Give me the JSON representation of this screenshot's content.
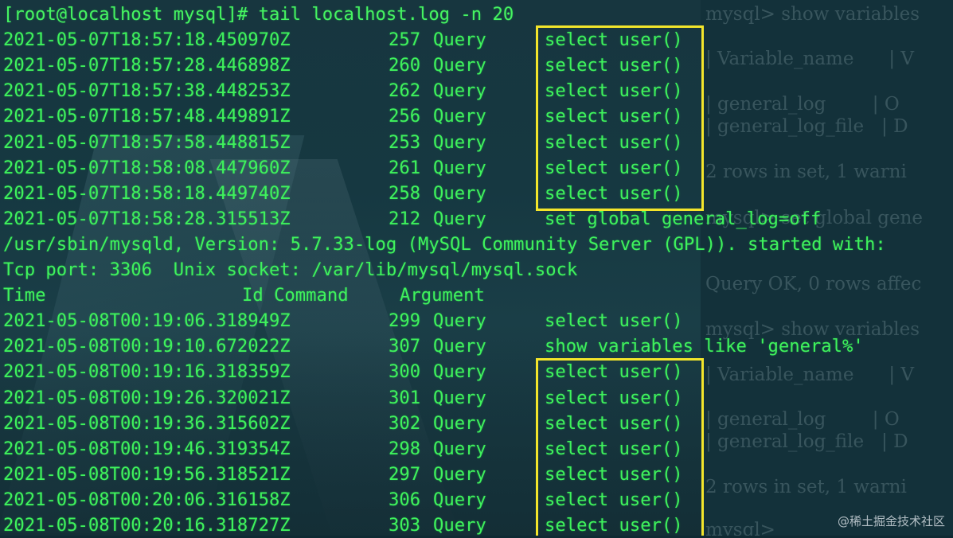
{
  "terminal": {
    "command_line": "[root@localhost mysql]# tail localhost.log -n 20",
    "log_lines_1": [
      {
        "time": "2021-05-07T18:57:18.450970Z",
        "id": "257",
        "command": "Query",
        "argument": "select user()"
      },
      {
        "time": "2021-05-07T18:57:28.446898Z",
        "id": "260",
        "command": "Query",
        "argument": "select user()"
      },
      {
        "time": "2021-05-07T18:57:38.448253Z",
        "id": "262",
        "command": "Query",
        "argument": "select user()"
      },
      {
        "time": "2021-05-07T18:57:48.449891Z",
        "id": "256",
        "command": "Query",
        "argument": "select user()"
      },
      {
        "time": "2021-05-07T18:57:58.448815Z",
        "id": "253",
        "command": "Query",
        "argument": "select user()"
      },
      {
        "time": "2021-05-07T18:58:08.447960Z",
        "id": "261",
        "command": "Query",
        "argument": "select user()"
      },
      {
        "time": "2021-05-07T18:58:18.449740Z",
        "id": "258",
        "command": "Query",
        "argument": "select user()"
      },
      {
        "time": "2021-05-07T18:58:28.315513Z",
        "id": "212",
        "command": "Query",
        "argument": "set global general_log=off"
      }
    ],
    "server_line": "/usr/sbin/mysqld, Version: 5.7.33-log (MySQL Community Server (GPL)). started with:",
    "socket_line": "Tcp port: 3306  Unix socket: /var/lib/mysql/mysql.sock",
    "header": {
      "time": "Time",
      "id_command": "Id Command",
      "argument": "Argument"
    },
    "log_lines_2": [
      {
        "time": "2021-05-08T00:19:06.318949Z",
        "id": "299",
        "command": "Query",
        "argument": "select user()"
      },
      {
        "time": "2021-05-08T00:19:10.672022Z",
        "id": "307",
        "command": "Query",
        "argument": "show variables like 'general%'"
      },
      {
        "time": "2021-05-08T00:19:16.318359Z",
        "id": "300",
        "command": "Query",
        "argument": "select user()"
      },
      {
        "time": "2021-05-08T00:19:26.320021Z",
        "id": "301",
        "command": "Query",
        "argument": "select user()"
      },
      {
        "time": "2021-05-08T00:19:36.315602Z",
        "id": "302",
        "command": "Query",
        "argument": "select user()"
      },
      {
        "time": "2021-05-08T00:19:46.319354Z",
        "id": "298",
        "command": "Query",
        "argument": "select user()"
      },
      {
        "time": "2021-05-08T00:19:56.318521Z",
        "id": "297",
        "command": "Query",
        "argument": "select user()"
      },
      {
        "time": "2021-05-08T00:20:06.316158Z",
        "id": "306",
        "command": "Query",
        "argument": "select user()"
      },
      {
        "time": "2021-05-08T00:20:16.318727Z",
        "id": "303",
        "command": "Query",
        "argument": "select user()"
      }
    ]
  },
  "background_panel": {
    "lines": [
      "mysql> show variables",
      "| Variable_name      | V",
      "| general_log        | O",
      "| general_log_file   | D",
      "2 rows in set, 1 warni",
      "mysql> set global gene",
      "Query OK, 0 rows affec",
      "mysql> show variables",
      "| Variable_name      | V",
      "| general_log        | O",
      "| general_log_file   | D",
      "2 rows in set, 1 warni",
      "mysql>"
    ]
  },
  "watermark": "@稀土掘金技术社区",
  "colors": {
    "terminal_text": "#3ff25c",
    "highlight_box": "#f3e52b",
    "background": "#0f2a33"
  }
}
